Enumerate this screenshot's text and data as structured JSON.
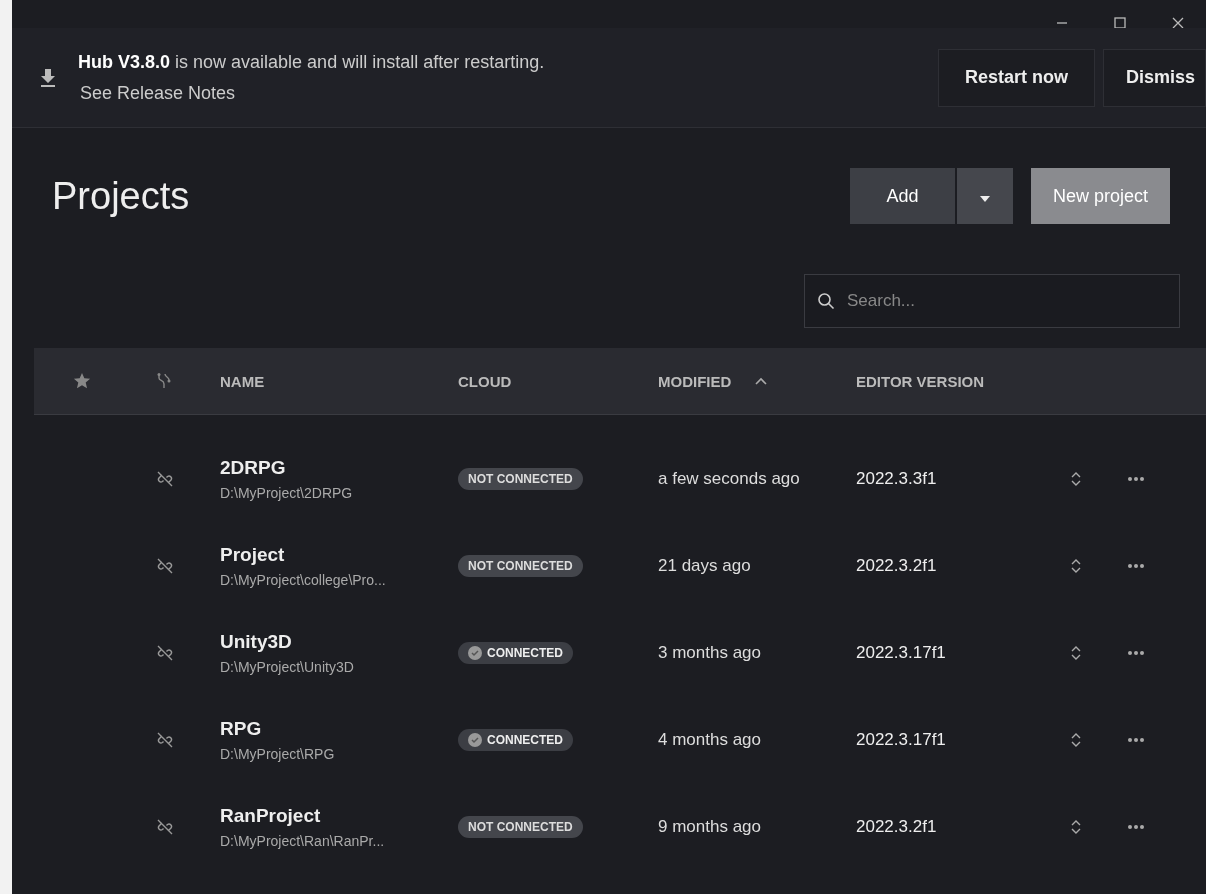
{
  "banner": {
    "message": "**Hub V3.8.0** is now available and will install after restarting.",
    "link": "See Release Notes",
    "buttons": [
      "Restart now",
      "Dismiss"
    ]
  },
  "title": "Projects",
  "actions": {
    "add": "Add",
    "new_project": "New project"
  },
  "search": {
    "placeholder": "Search..."
  },
  "table": {
    "columns": [
      "NAME",
      "CLOUD",
      "MODIFIED",
      "EDITOR VERSION"
    ],
    "rows": [
      {
        "name": "2DRPG",
        "path": "D:\\MyProject\\2DRPG",
        "cloud": {
          "label": "NOT CONNECTED",
          "connected": false
        },
        "modified": "a few seconds ago",
        "version": "2022.3.3f1"
      },
      {
        "name": "Project",
        "path": "D:\\MyProject\\college\\Pro...",
        "cloud": {
          "label": "NOT CONNECTED",
          "connected": false
        },
        "modified": "21 days ago",
        "version": "2022.3.2f1"
      },
      {
        "name": "Unity3D",
        "path": "D:\\MyProject\\Unity3D",
        "cloud": {
          "label": "CONNECTED",
          "connected": true
        },
        "modified": "3 months ago",
        "version": "2022.3.17f1"
      },
      {
        "name": "RPG",
        "path": "D:\\MyProject\\RPG",
        "cloud": {
          "label": "CONNECTED",
          "connected": true
        },
        "modified": "4 months ago",
        "version": "2022.3.17f1"
      },
      {
        "name": "RanProject",
        "path": "D:\\MyProject\\Ran\\RanPr...",
        "cloud": {
          "label": "NOT CONNECTED",
          "connected": false
        },
        "modified": "9 months ago",
        "version": "2022.3.2f1"
      }
    ]
  }
}
